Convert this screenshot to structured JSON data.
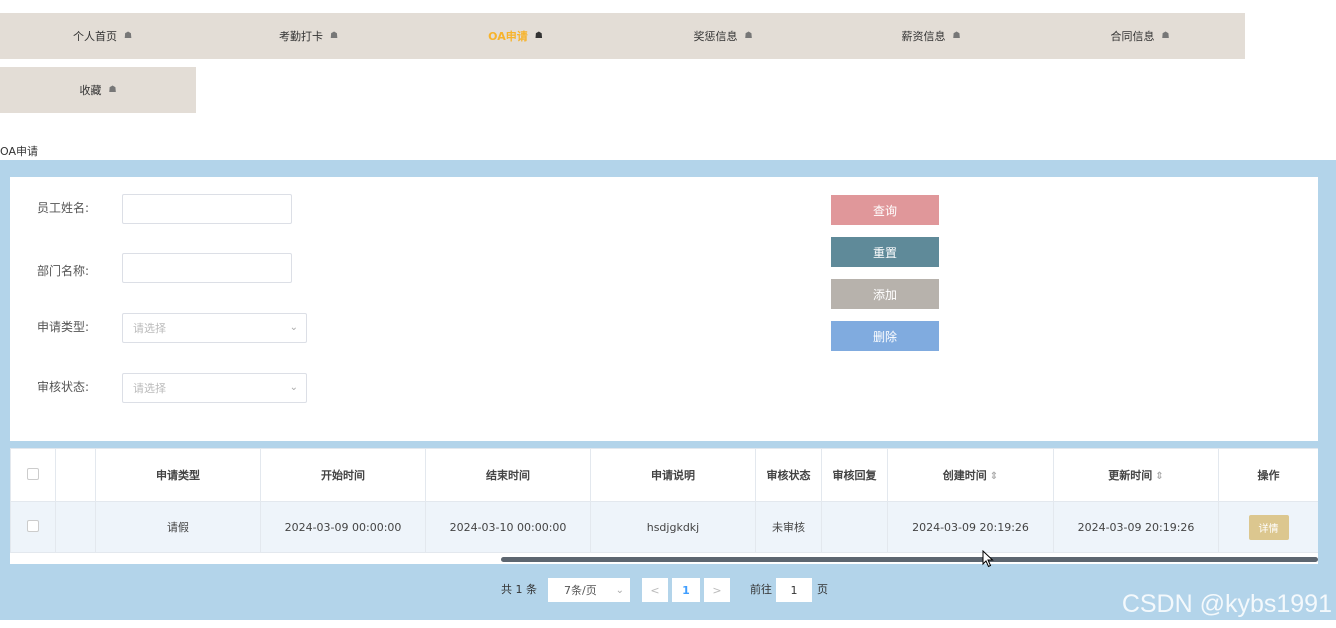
{
  "nav": {
    "items": [
      {
        "label": "个人首页",
        "icon": "home-icon"
      },
      {
        "label": "考勤打卡",
        "icon": "home-icon"
      },
      {
        "label": "OA申请",
        "icon": "home-icon",
        "active": true
      },
      {
        "label": "奖惩信息",
        "icon": "home-icon"
      },
      {
        "label": "薪资信息",
        "icon": "home-icon"
      },
      {
        "label": "合同信息",
        "icon": "home-icon"
      },
      {
        "label": "收藏",
        "icon": "home-icon"
      }
    ],
    "active_color": "#f7b32b",
    "bg_color": "#e3ddd6"
  },
  "page": {
    "title": "OA申请"
  },
  "search": {
    "employee_name_label": "员工姓名:",
    "employee_name_value": "",
    "department_label": "部门名称:",
    "department_value": "",
    "apply_type_label": "申请类型:",
    "apply_type_placeholder": "请选择",
    "audit_status_label": "审核状态:",
    "audit_status_placeholder": "请选择"
  },
  "actions": {
    "query": {
      "label": "查询",
      "color": "#e0979a"
    },
    "reset": {
      "label": "重置",
      "color": "#5f8a99"
    },
    "add": {
      "label": "添加",
      "color": "#b7b2ac"
    },
    "delete": {
      "label": "删除",
      "color": "#80abdf"
    }
  },
  "table": {
    "columns": [
      "申请类型",
      "开始时间",
      "结束时间",
      "申请说明",
      "审核状态",
      "审核回复",
      "创建时间",
      "更新时间",
      "操作"
    ],
    "rows": [
      {
        "apply_type": "请假",
        "start_time": "2024-03-09 00:00:00",
        "end_time": "2024-03-10 00:00:00",
        "description": "hsdjgkdkj",
        "audit_status": "未审核",
        "audit_reply": "",
        "created": "2024-03-09 20:19:26",
        "updated": "2024-03-09 20:19:26",
        "action_label": "详情"
      }
    ]
  },
  "pagination": {
    "total": "共 1 条",
    "page_size": "7条/页",
    "prev": "<",
    "current_page": "1",
    "next": ">",
    "goto_prefix": "前往",
    "goto_value": "1",
    "goto_suffix": "页"
  },
  "watermark": "CSDN @kybs1991",
  "colors": {
    "band": "#b3d4ea",
    "detail_button": "#dcc78f"
  }
}
